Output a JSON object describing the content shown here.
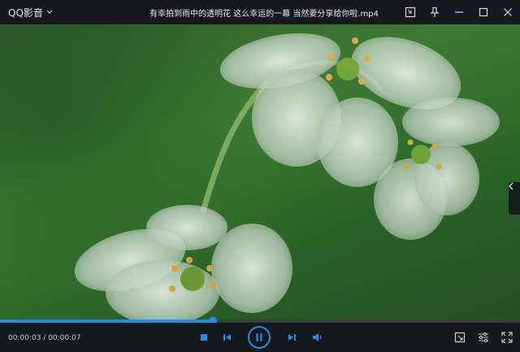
{
  "app": {
    "name": "QQ影音"
  },
  "window": {
    "title": "有幸拍到雨中的透明花 这么幸运的一幕 当然要分享给你啦.mp4"
  },
  "playback": {
    "current_time": "00:00:03",
    "separator": " / ",
    "total_time": "00:00:07",
    "progress": 0.41
  },
  "colors": {
    "accent": "#1e8fe6",
    "chrome": "#16181c"
  },
  "icons": {
    "brand_menu": "chevron-down-icon",
    "screenshot": "screenshot-icon",
    "pin": "pin-icon",
    "minimize": "minimize-icon",
    "maximize": "maximize-icon",
    "close": "close-icon",
    "stop": "stop-icon",
    "previous": "previous-icon",
    "pause": "pause-icon",
    "next": "next-icon",
    "volume": "volume-icon",
    "capture": "capture-icon",
    "settings": "equalizer-icon",
    "fullscreen": "fullscreen-icon",
    "side_panel": "chevron-left-icon"
  }
}
